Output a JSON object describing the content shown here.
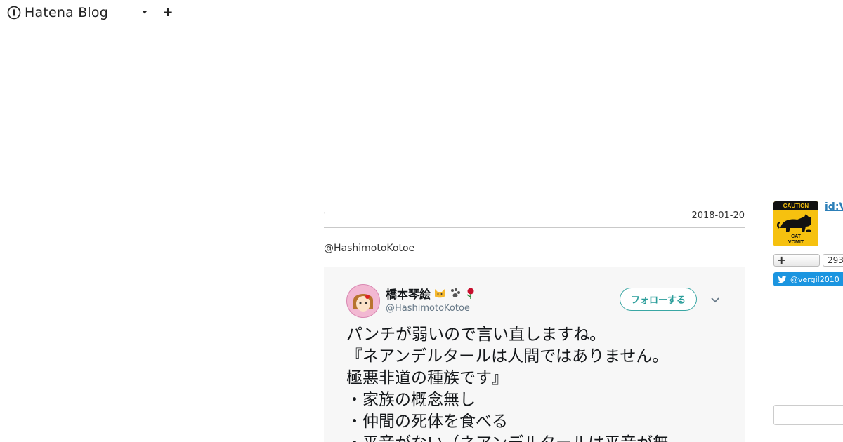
{
  "header": {
    "brand": "Hatena Blog",
    "plus_glyph": "+"
  },
  "entry": {
    "category": "' '",
    "date": "2018-01-20",
    "mention": "@HashimotoKotoe"
  },
  "tweet": {
    "name": "橋本琴絵",
    "handle": "@HashimotoKotoe",
    "follow_label": "フォローする",
    "lines": [
      "パンチが弱いので言い直しますね。",
      "『ネアンデルタールは人間ではありません。",
      "極悪非道の種族です』",
      "・家族の概念無し",
      "・仲間の死体を食べる",
      "・平音がない（ネアンデルタールは平音が無"
    ]
  },
  "sidebar": {
    "profile_id": "id:V",
    "profile_icon_top": "CAUTION",
    "profile_icon_bottom": "CAT VOMIT",
    "follow_glyph": "+",
    "follow_count": "293",
    "twitter_label": "@vergil2010"
  },
  "colors": {
    "link": "#2c7fb8",
    "twitter": "#1b95e0",
    "follow_teal": "#2a9d9a"
  }
}
